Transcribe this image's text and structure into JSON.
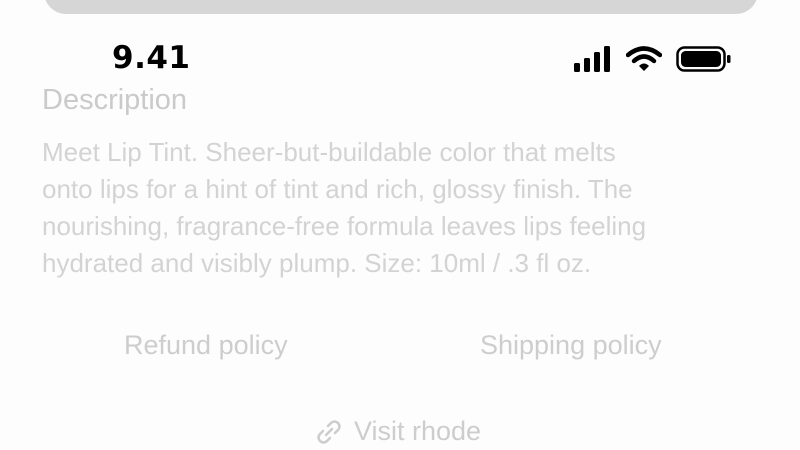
{
  "status_bar": {
    "time": "9.41",
    "icons": [
      "signal-icon",
      "wifi-icon",
      "battery-icon"
    ]
  },
  "description": {
    "title": "Description",
    "lines": [
      "Meet Lip Tint. Sheer-but-buildable color that melts",
      "onto lips for a hint of tint and rich, glossy finish. The",
      "nourishing, fragrance-free formula leaves lips feeling",
      "hydrated and visibly plump. Size: 10ml / .3 fl oz."
    ]
  },
  "policies": {
    "refund_label": "Refund policy",
    "shipping_label": "Shipping policy"
  },
  "visit": {
    "icon": "link-icon",
    "label": "Visit rhode"
  },
  "colors": {
    "top_bar": "#d6d6d6",
    "faded_text": "#cdcdcd",
    "status_text": "#000000"
  }
}
